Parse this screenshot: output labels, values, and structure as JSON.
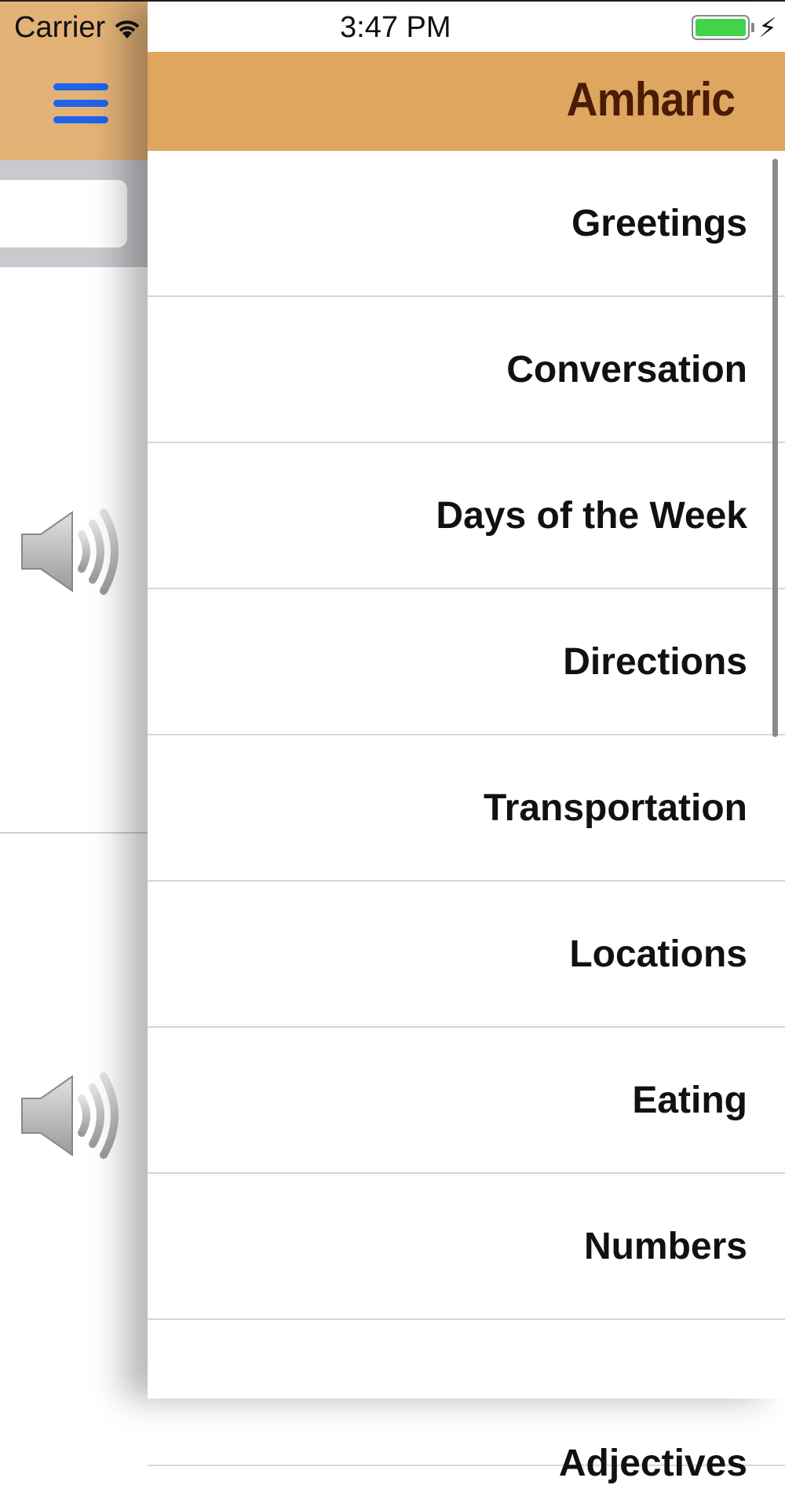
{
  "status_bar": {
    "carrier": "Carrier",
    "time": "3:47 PM",
    "wifi_icon": "wifi-icon",
    "battery_icon": "battery-charging-icon",
    "bolt": "⚡"
  },
  "header": {
    "title": "Amharic",
    "menu_icon": "hamburger-menu-icon"
  },
  "menu": {
    "items": [
      {
        "label": "Greetings"
      },
      {
        "label": "Conversation"
      },
      {
        "label": "Days of the Week"
      },
      {
        "label": "Directions"
      },
      {
        "label": "Transportation"
      },
      {
        "label": "Locations"
      },
      {
        "label": "Eating"
      },
      {
        "label": "Numbers"
      },
      {
        "label": "Adjectives"
      }
    ]
  },
  "underlying_view": {
    "speaker_icon": "speaker-icon",
    "search_placeholder": ""
  },
  "colors": {
    "header_bg": "#dfa660",
    "title_color": "#4a1c05",
    "menu_icon_color": "#1f63ea"
  }
}
